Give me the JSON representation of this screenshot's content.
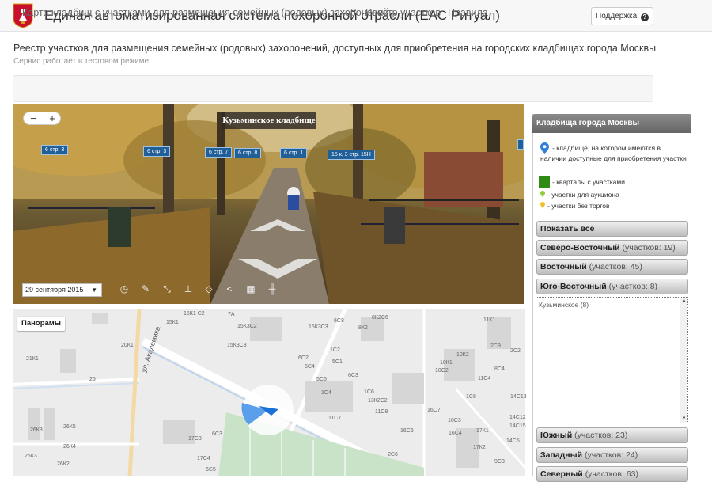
{
  "header": {
    "title": "Единая автоматизированная система похоронной отрасли (ЕАС Ритуал)",
    "support_label": "Поддержка"
  },
  "page": {
    "heading": "Реестр участков для размещения семейных (родовых) захоронений, доступных для приобретения на городских кладбищах города Москвы",
    "test_notice": "Сервис работает в тестовом режиме"
  },
  "nav": {
    "items": [
      {
        "label": "Карта кладбищ с участками для размещения семейных (родовых) захоронений"
      },
      {
        "label": "Реестр участков"
      },
      {
        "label": "Правила"
      }
    ]
  },
  "panorama": {
    "zoom_out": "−",
    "zoom_in": "+",
    "title": "Кузьминское кладбище",
    "date": "29 сентября 2015",
    "tags": [
      "6 стр. 3",
      "6 стр. 3",
      "6 стр. 7",
      "6 стр. 8",
      "6 стр. 1",
      "15 к. 3 стр. 15Н"
    ]
  },
  "map": {
    "panoramas_label": "Панорамы",
    "street_label": "ул. Академика",
    "labels": [
      "15К1 С2",
      "15К1",
      "7А",
      "15К3С2",
      "15К3С3",
      "6С8",
      "8К2С6",
      "11К1",
      "20К1",
      "21К1",
      "6С2",
      "1С2",
      "8К2",
      "15К3С3",
      "5С1",
      "25",
      "6С3",
      "5С6",
      "5С4",
      "1С6",
      "13К2С2",
      "26К3",
      "26К5",
      "26К4",
      "17С3",
      "6С3",
      "1С4",
      "26К3",
      "17С4",
      "26К2",
      "6С5",
      "11С8",
      "11С7",
      "16С7",
      "16С6",
      "16С4",
      "16С3",
      "10С2",
      "10К1",
      "10К2",
      "11С4",
      "17К1",
      "17К2",
      "14С13",
      "14С12",
      "14С15",
      "14С5",
      "2С9",
      "8С4",
      "2С2",
      "1С8",
      "9С3",
      "2С6"
    ]
  },
  "sidebar": {
    "title": "Кладбища города Москвы",
    "legend": [
      {
        "text": "- кладбище, на котором имеются в наличии доступные для приобретения участки"
      },
      {
        "text": "- кварталы с участками"
      },
      {
        "text": "- участки для аукциона"
      },
      {
        "text": "- участки без торгов"
      }
    ],
    "show_all": "Показать все",
    "regions": [
      {
        "name": "Северо-Восточный",
        "count": "(участков: 19)"
      },
      {
        "name": "Восточный",
        "count": "(участков: 45)"
      },
      {
        "name": "Юго-Восточный",
        "count": "(участков: 8)"
      },
      {
        "name": "Южный",
        "count": "(участков: 23)"
      },
      {
        "name": "Западный",
        "count": "(участков: 24)"
      },
      {
        "name": "Северный",
        "count": "(участков: 63)"
      }
    ],
    "list": [
      {
        "label": "Кузьминское (8)"
      }
    ]
  },
  "colors": {
    "tag_blue": "#215f98",
    "legend_pin": "#2d7fd8",
    "legend_square": "#2e8b14",
    "auction_pin": "#8fcf3a",
    "notender_pin": "#f2c12e"
  }
}
